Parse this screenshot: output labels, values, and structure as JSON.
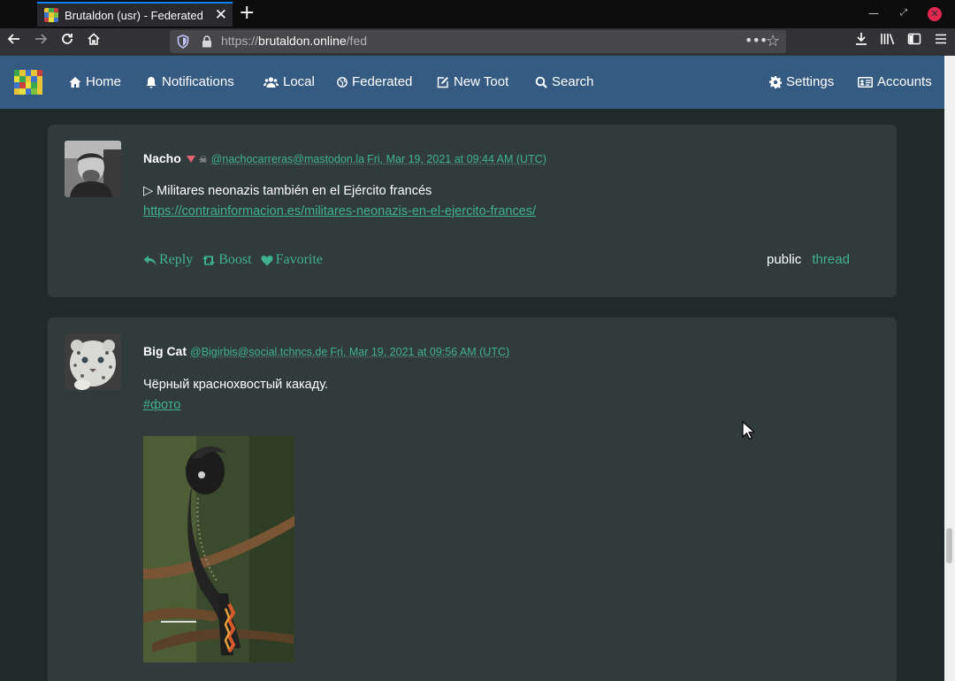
{
  "browser": {
    "tab_title": "Brutaldon (usr) - Federated",
    "url_scheme": "https://",
    "url_host": "brutaldon.online",
    "url_path": "/fed"
  },
  "site": {
    "nav": {
      "home": "Home",
      "notifications": "Notifications",
      "local": "Local",
      "federated": "Federated",
      "new_toot": "New Toot",
      "search": "Search",
      "settings": "Settings",
      "accounts": "Accounts"
    }
  },
  "posts": [
    {
      "author": "Nacho",
      "handle": "@nachocarreras@mastodon.la",
      "timestamp": "Fri, Mar 19, 2021 at 09:44 AM (UTC)",
      "text": "▷ Militares neonazis también en el Ejército francés",
      "link": "https://contrainformacion.es/militares-neonazis-en-el-ejercito-frances/",
      "actions": {
        "reply": "Reply",
        "boost": "Boost",
        "favorite": "Favorite"
      },
      "visibility": "public",
      "thread": "thread"
    },
    {
      "author": "Big Cat",
      "handle": "@Bigirbis@social.tchncs.de",
      "timestamp": "Fri, Mar 19, 2021 at 09:56 AM (UTC)",
      "text": "Чёрный краснохвостый какаду.",
      "hashtag": "#фото"
    }
  ],
  "colors": {
    "nav_bg": "#365b82",
    "page_bg": "#202a2b",
    "card_bg": "#313b3c",
    "link": "#3fb18f"
  }
}
